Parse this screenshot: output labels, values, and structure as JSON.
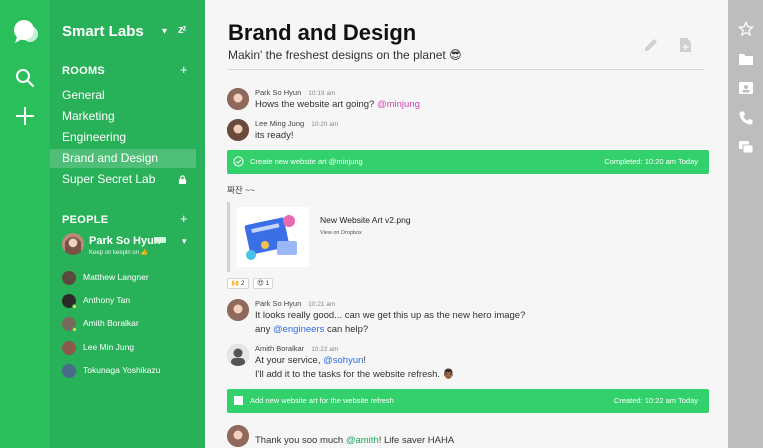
{
  "workspace": {
    "name": "Smart Labs",
    "dnd_icon_text": "zᶻ"
  },
  "rooms": {
    "header": "ROOMS",
    "items": [
      {
        "label": "General"
      },
      {
        "label": "Marketing"
      },
      {
        "label": "Engineering"
      },
      {
        "label": "Brand and Design",
        "active": true
      },
      {
        "label": "Super Secret Lab",
        "locked": true
      }
    ]
  },
  "people": {
    "header": "PEOPLE",
    "me": {
      "name": "Park So Hyun",
      "status": "Keep on keepin on 👍"
    },
    "items": [
      {
        "name": "Matthew Langner"
      },
      {
        "name": "Anthony Tan"
      },
      {
        "name": "Amith Boralkar"
      },
      {
        "name": "Lee Min Jung"
      },
      {
        "name": "Tokunaga Yoshikazu"
      }
    ]
  },
  "channel": {
    "title": "Brand and Design",
    "topic": "Makin' the freshest designs on the planet 😎"
  },
  "messages": [
    {
      "author": "Park So Hyun",
      "time": "10:19 am",
      "text": "Hows the website art going? ",
      "mention": "@minjung"
    },
    {
      "author": "Lee Ming Jung",
      "time": "10:20 am",
      "text": "its ready!"
    },
    {
      "author": "Park So Hyun",
      "time": "10:21 am",
      "line1": "It looks really good... can we get this up as the new hero image?",
      "line2_pre": "any ",
      "line2_mention": "@engineers",
      "line2_post": " can help?"
    },
    {
      "author": "Amith Boralkar",
      "time": "10:22 am",
      "line1_pre": "At your service, ",
      "line1_mention": "@sohyun",
      "line1_post": "!",
      "line2": "I'll add it to the tasks for the website refresh. 👨🏾"
    },
    {
      "author": "Park So Hyun",
      "time": "",
      "text_pre": "Thank you soo much ",
      "mention": "@amith",
      "text_post": "! Life saver HAHA"
    }
  ],
  "tasks": [
    {
      "text": "Create new website art @minjung",
      "meta": "Completed: 10:20 am Today",
      "done": true
    },
    {
      "text": "Add new website art for the website refresh",
      "meta": "Created: 10:22 am Today",
      "done": false
    }
  ],
  "plain_message": "짜잔 ~~",
  "file": {
    "name": "New Website Art v2.png",
    "source": "View on Dropbox"
  },
  "reactions": [
    {
      "emoji": "🙌",
      "count": "2"
    },
    {
      "emoji": "😍",
      "count": "1"
    }
  ],
  "colors": {
    "rail": "#2bbf5c",
    "sidebar": "#29b15a",
    "task_bar": "#33d16b",
    "right_rail": "#bdbdbd",
    "mention_pink": "#d346b8",
    "mention_blue": "#2d6fe0",
    "mention_green": "#1ea85b"
  },
  "icons": {
    "rail": [
      "chat-logo-icon",
      "search-icon",
      "add-icon"
    ],
    "header": [
      "edit-pencil-icon",
      "new-doc-icon"
    ],
    "right_rail": [
      "star-icon",
      "folder-icon",
      "contact-card-icon",
      "phone-icon",
      "windows-icon"
    ]
  }
}
